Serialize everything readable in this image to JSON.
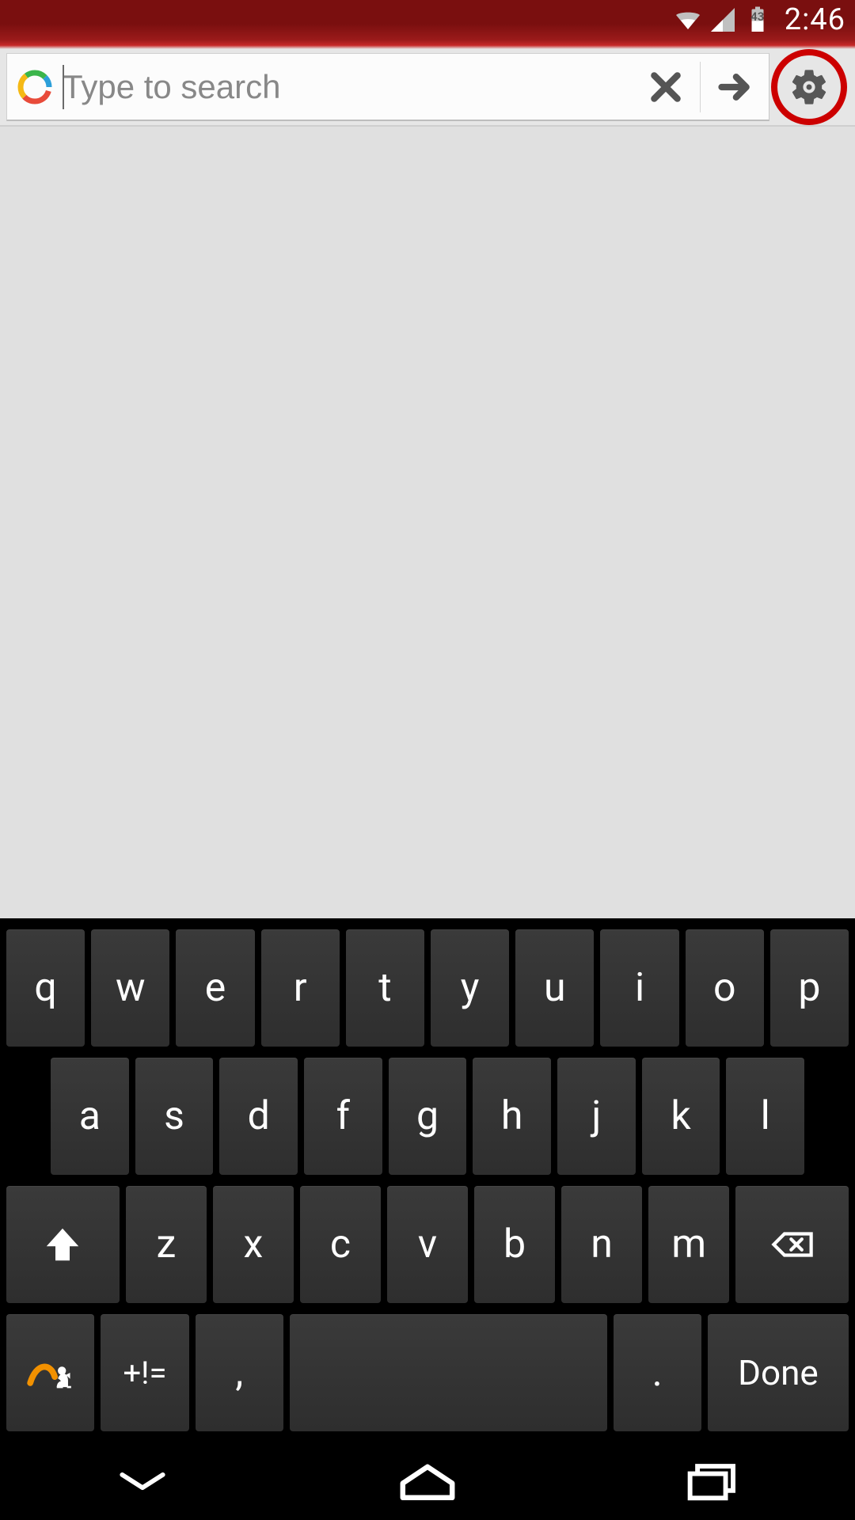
{
  "status": {
    "time": "2:46",
    "battery_percent": "43"
  },
  "search": {
    "placeholder": "Type to search",
    "value": ""
  },
  "keyboard": {
    "row1": [
      "q",
      "w",
      "e",
      "r",
      "t",
      "y",
      "u",
      "i",
      "o",
      "p"
    ],
    "row2": [
      "a",
      "s",
      "d",
      "f",
      "g",
      "h",
      "j",
      "k",
      "l"
    ],
    "row3": [
      "z",
      "x",
      "c",
      "v",
      "b",
      "n",
      "m"
    ],
    "row4": {
      "symbols_label": "+!=",
      "comma_label": ",",
      "period_label": ".",
      "done_label": "Done"
    }
  }
}
